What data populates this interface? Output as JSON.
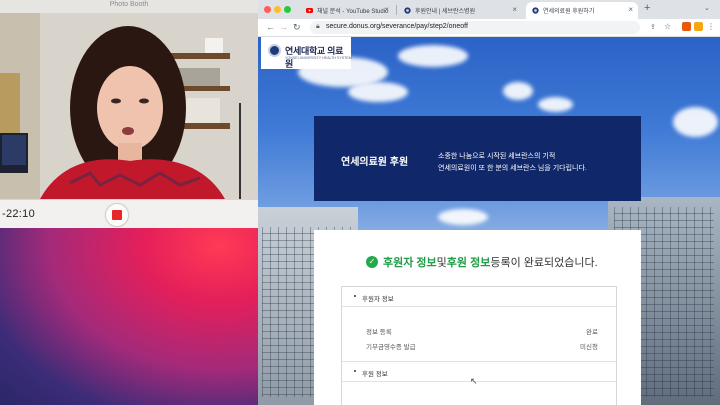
{
  "photobooth": {
    "title": "Photo Booth",
    "timer": "-22:10"
  },
  "browser": {
    "tabs": [
      {
        "label": "채널 분석 - YouTube Studio",
        "favicon": "youtube-icon"
      },
      {
        "label": "후원안내 | 세브란스병원",
        "favicon": "severance-icon"
      },
      {
        "label": "연세의료원 후원하기",
        "favicon": "severance-icon",
        "active": true
      }
    ],
    "url": "secure.donus.org/severance/pay/step2/oneoff"
  },
  "page": {
    "logo_name": "연세대학교 의료원",
    "logo_sub": "YONSEI UNIVERSITY HEALTH SYSTEM",
    "banner_title": "연세의료원 후원",
    "banner_desc1": "소중한 나눔으로 시작된 세브란스의 기적",
    "banner_desc2": "연세의료원이 또 한 분의 세브란스 님을 기다립니다.",
    "done_part1": "후원자 정보",
    "done_part2": " 및 ",
    "done_part3": "후원 정보",
    "done_part4": " 등록이 완료되었습니다.",
    "section1_title": "후원자 정보",
    "rows": [
      {
        "label": "정보 등록",
        "value": "완료"
      },
      {
        "label": "기부금영수증 발급",
        "value": "미신청"
      }
    ],
    "section2_title": "후원 정보"
  },
  "colors": {
    "banner": "#10286a",
    "accent_green": "#1f9c45",
    "record_red": "#e8262a"
  }
}
